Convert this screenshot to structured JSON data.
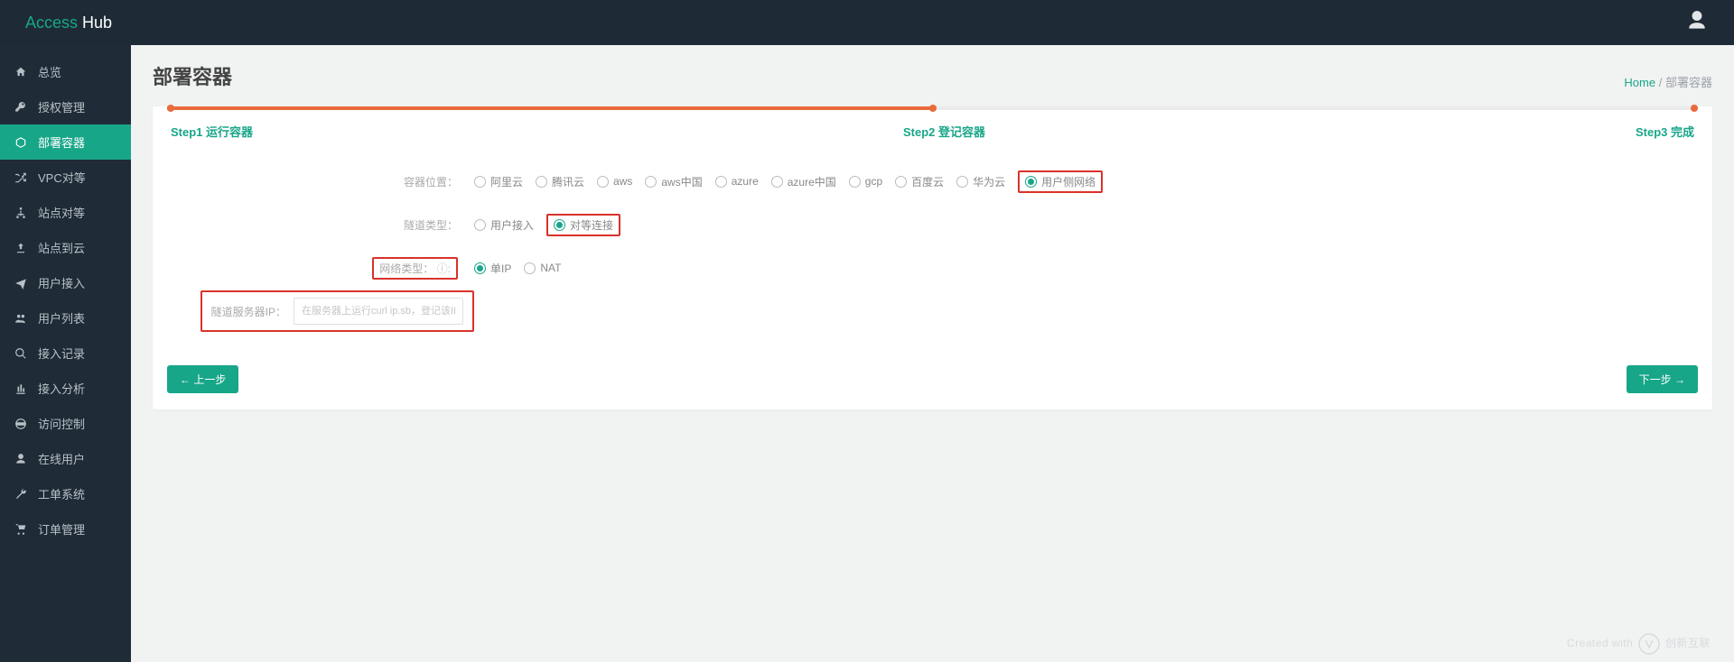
{
  "brand": {
    "accent": "Access",
    "plain": " Hub"
  },
  "sidebar": {
    "items": [
      {
        "icon": "home",
        "label": "总览",
        "active": false
      },
      {
        "icon": "key",
        "label": "授权管理",
        "active": false
      },
      {
        "icon": "cube",
        "label": "部署容器",
        "active": true
      },
      {
        "icon": "random",
        "label": "VPC对等",
        "active": false
      },
      {
        "icon": "sitemap",
        "label": "站点对等",
        "active": false
      },
      {
        "icon": "upload",
        "label": "站点到云",
        "active": false
      },
      {
        "icon": "plane",
        "label": "用户接入",
        "active": false
      },
      {
        "icon": "users",
        "label": "用户列表",
        "active": false
      },
      {
        "icon": "search",
        "label": "接入记录",
        "active": false
      },
      {
        "icon": "chart",
        "label": "接入分析",
        "active": false
      },
      {
        "icon": "globe",
        "label": "访问控制",
        "active": false
      },
      {
        "icon": "user",
        "label": "在线用户",
        "active": false
      },
      {
        "icon": "wrench",
        "label": "工单系统",
        "active": false
      },
      {
        "icon": "cart",
        "label": "订单管理",
        "active": false
      }
    ]
  },
  "page": {
    "title": "部署容器",
    "breadcrumb": {
      "home": "Home",
      "sep": "/",
      "current": "部署容器"
    }
  },
  "wizard": {
    "step1": "Step1 运行容器",
    "step2": "Step2 登记容器",
    "step3": "Step3 完成",
    "progress_pct": 50
  },
  "form": {
    "location": {
      "label": "容器位置：",
      "options": [
        "阿里云",
        "腾讯云",
        "aws",
        "aws中国",
        "azure",
        "azure中国",
        "gcp",
        "百度云",
        "华为云",
        "用户侧网络"
      ],
      "selected": "用户侧网络",
      "highlight_selected": true
    },
    "tunnel_type": {
      "label": "隧道类型：",
      "options": [
        "用户接入",
        "对等连接"
      ],
      "selected": "对等连接",
      "highlight_selected": true
    },
    "net_type": {
      "label": "网络类型：",
      "options": [
        "单IP",
        "NAT"
      ],
      "selected": "单IP",
      "highlight_label": true,
      "hint_after_label": "ⓘ:"
    },
    "tunnel_ip": {
      "label": "隧道服务器IP：",
      "value": "",
      "placeholder": "在服务器上运行curl ip.sb，登记该IP",
      "highlight_row": true
    }
  },
  "buttons": {
    "prev": "← 上一步",
    "next": "下一步 →"
  },
  "footer": {
    "watermark": "Created with",
    "brand": "创新互联"
  }
}
